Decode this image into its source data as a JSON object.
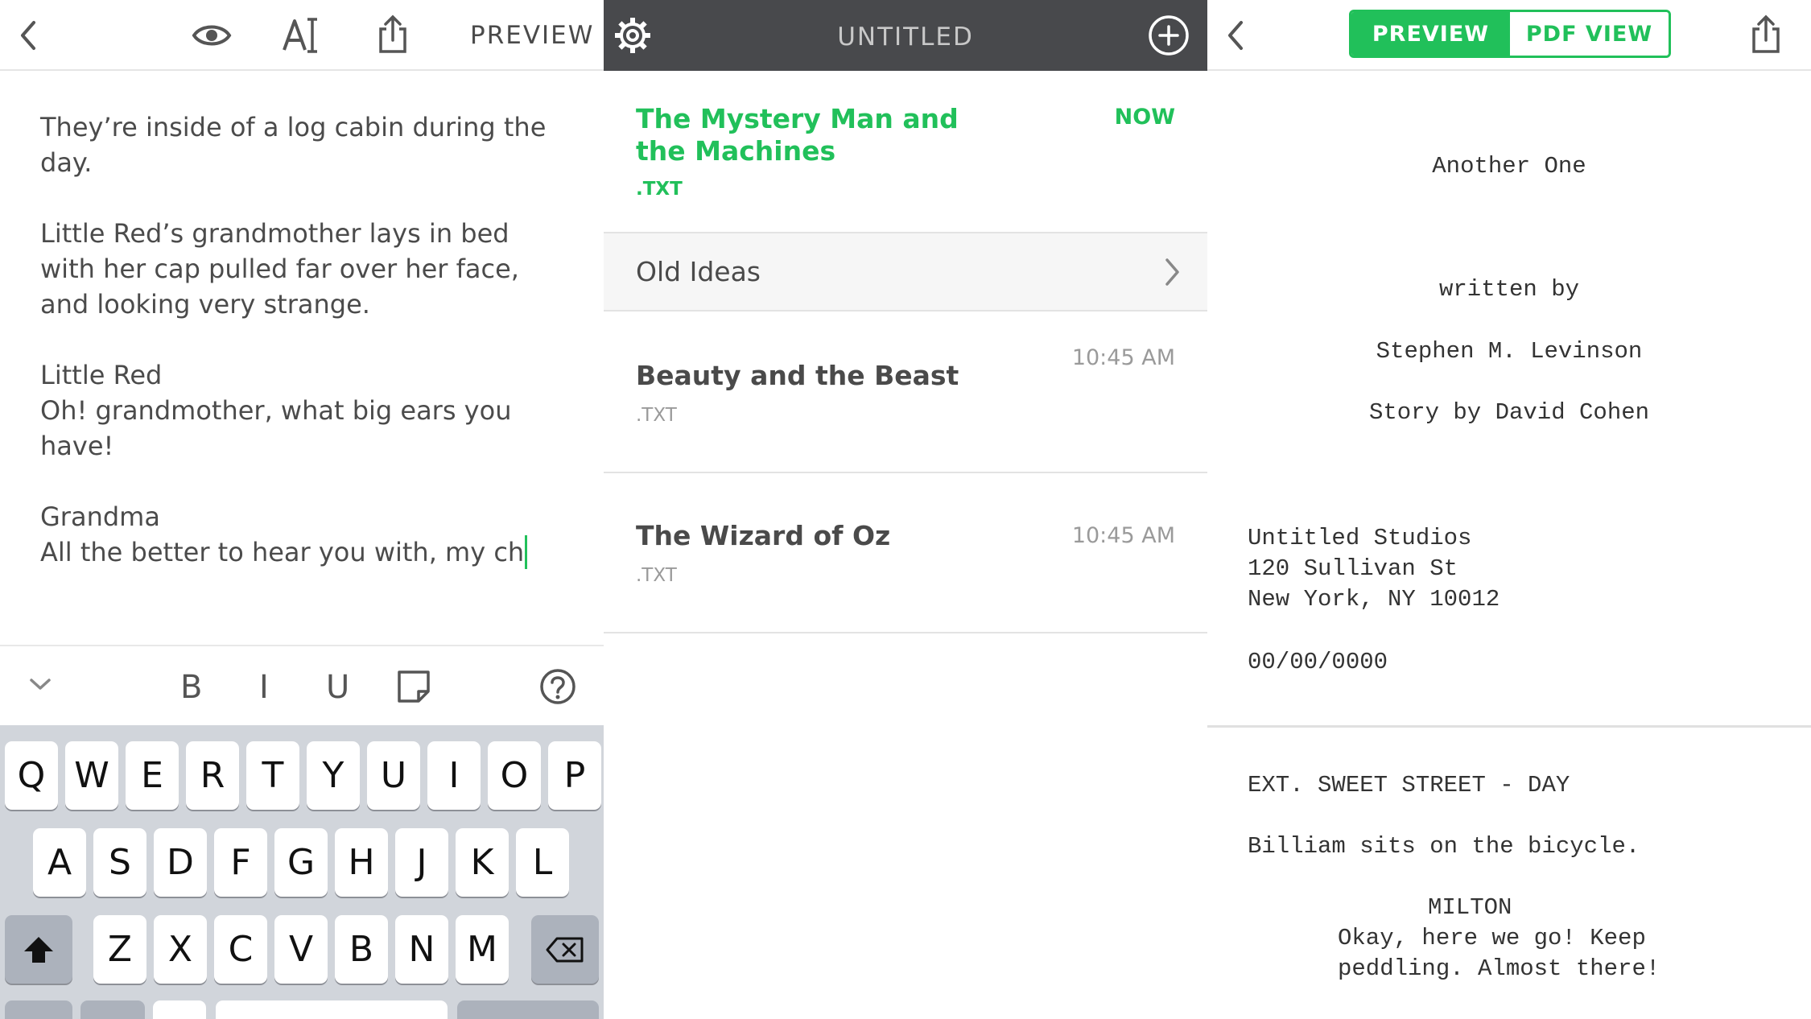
{
  "colors": {
    "accent": "#21c05a",
    "dark_bar": "#48494c",
    "keyboard_bg": "#d1d5db"
  },
  "editor_panel": {
    "preview_label": "PREVIEW",
    "icons": [
      "back-chevron-icon",
      "eye-icon",
      "text-style-icon",
      "share-icon"
    ],
    "paragraphs": [
      "They’re inside of a log cabin during the day.",
      "Little Red’s grandmother lays in bed with her cap pulled far over her face, and looking very strange.",
      "Little Red\nOh! grandmother, what big ears you have!",
      "Grandma\nAll the better to hear you with, my ch"
    ],
    "format_bar": {
      "bold": "B",
      "italic": "I",
      "underline": "U"
    },
    "keyboard": {
      "row1": [
        "Q",
        "W",
        "E",
        "R",
        "T",
        "Y",
        "U",
        "I",
        "O",
        "P"
      ],
      "row2": [
        "A",
        "S",
        "D",
        "F",
        "G",
        "H",
        "J",
        "K",
        "L"
      ],
      "row3": [
        "Z",
        "X",
        "C",
        "V",
        "B",
        "N",
        "M"
      ]
    }
  },
  "files_panel": {
    "title": "UNTITLED",
    "active_file": {
      "title": "The Mystery Man and the Machines",
      "ext": ".TXT",
      "time": "NOW"
    },
    "folder": {
      "label": "Old Ideas"
    },
    "files": [
      {
        "title": "Beauty and the Beast",
        "ext": ".TXT",
        "time": "10:45 AM"
      },
      {
        "title": "The Wizard of Oz",
        "ext": ".TXT",
        "time": "10:45 AM"
      }
    ]
  },
  "preview_panel": {
    "tabs": {
      "preview": "PREVIEW",
      "pdf": "PDF VIEW"
    },
    "title_page": {
      "title": "Another One",
      "written_by": "written by",
      "author": "Stephen M. Levinson",
      "story_by": "Story by David Cohen",
      "address1": "Untitled Studios",
      "address2": "120 Sullivan St",
      "address3": "New York, NY 10012",
      "date": "00/00/0000"
    },
    "script": {
      "scene_heading": "EXT. SWEET STREET - DAY",
      "action": "Billiam sits on the bicycle.",
      "character": "MILTON",
      "dialogue1": "Okay, here we go! Keep",
      "dialogue2": "peddling. Almost there!"
    }
  }
}
